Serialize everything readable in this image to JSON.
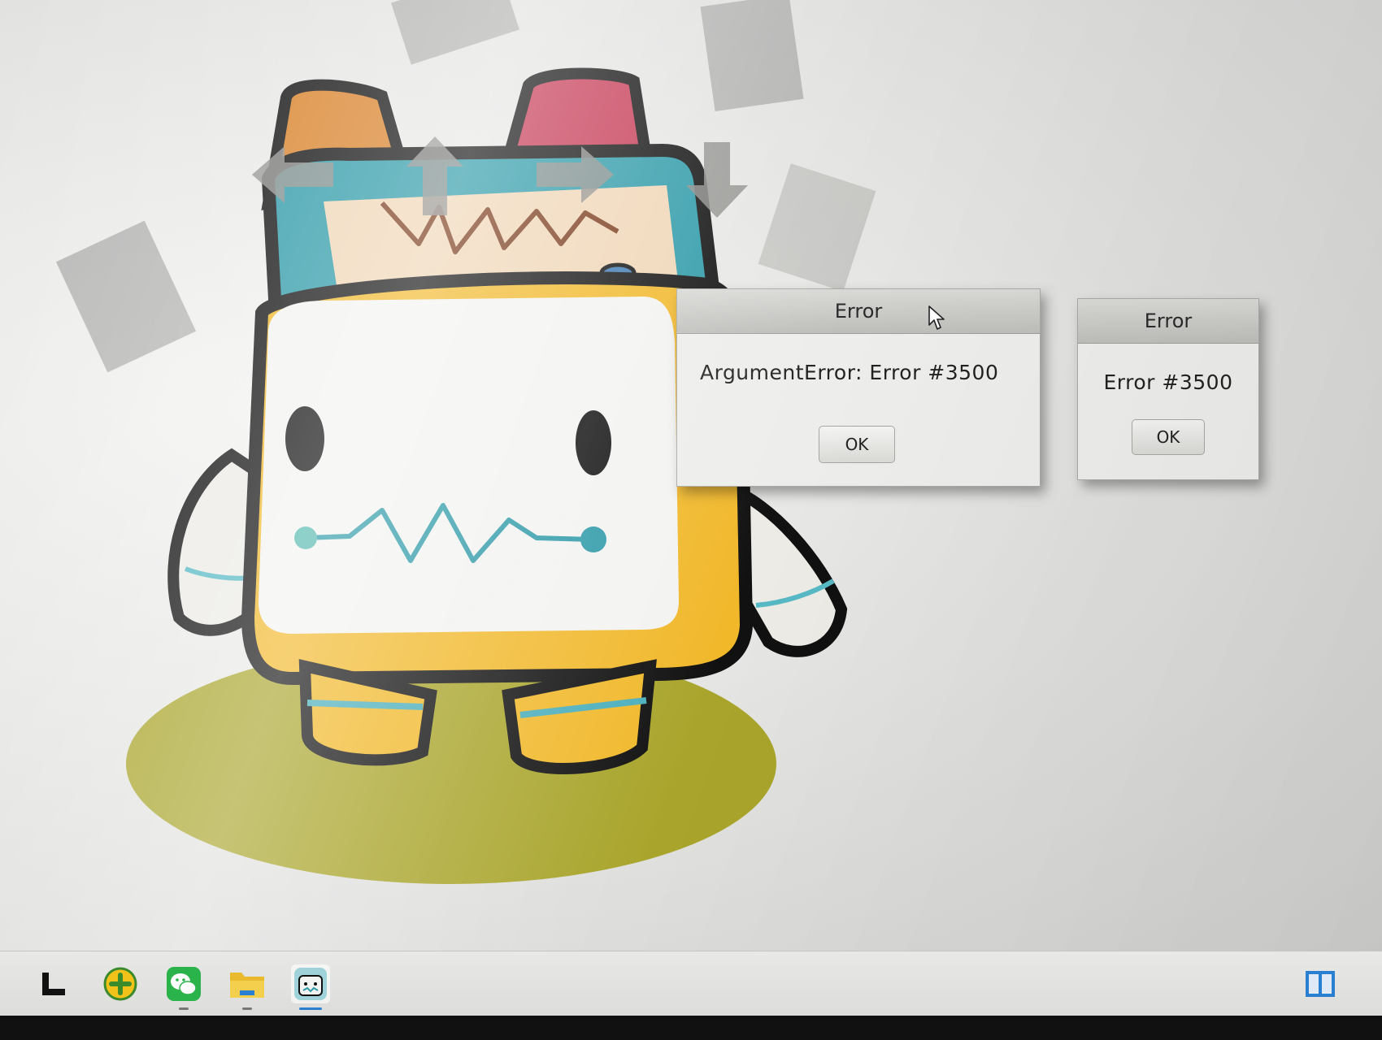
{
  "dialogs": {
    "main": {
      "title": "Error",
      "message": "ArgumentError: Error #3500",
      "ok_label": "OK"
    },
    "secondary": {
      "title": "Error",
      "message": "Error #3500",
      "ok_label": "OK"
    }
  },
  "taskbar": {
    "items": [
      {
        "icon": "launcher-icon"
      },
      {
        "icon": "app-plus-icon"
      },
      {
        "icon": "wechat-icon"
      },
      {
        "icon": "file-explorer-icon"
      },
      {
        "icon": "mascot-app-icon",
        "active": true
      }
    ],
    "tray_icon": "window-layout-icon"
  },
  "colors": {
    "mascot_yellow": "#f1b82a",
    "mascot_teal": "#2d9aa8",
    "ground_olive": "#a9a52c",
    "dialog_bg": "#ededeb",
    "dialog_title": "#c8c8c5"
  }
}
